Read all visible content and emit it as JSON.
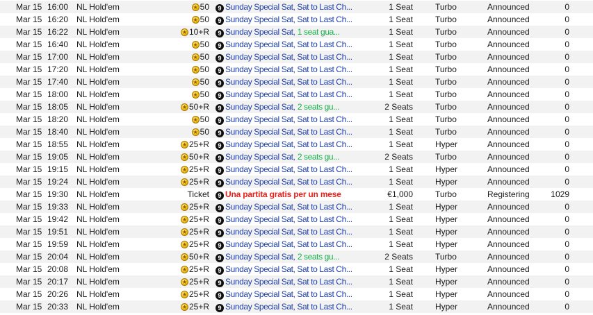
{
  "rows": [
    {
      "date": "Mar 15",
      "time": "16:00",
      "game": "NL Hold'em",
      "buyin": "50",
      "name": "Sunday Special Sat, Sat to Last Ch...",
      "name_extra": "",
      "prize": "1 Seat",
      "speed": "Turbo",
      "status": "Announced",
      "players": "0"
    },
    {
      "date": "Mar 15",
      "time": "16:20",
      "game": "NL Hold'em",
      "buyin": "50",
      "name": "Sunday Special Sat, Sat to Last Ch...",
      "name_extra": "",
      "prize": "1 Seat",
      "speed": "Turbo",
      "status": "Announced",
      "players": "0"
    },
    {
      "date": "Mar 15",
      "time": "16:22",
      "game": "NL Hold'em",
      "buyin": "10+R",
      "name": "Sunday Special Sat,",
      "name_extra": "1 seat gua...",
      "prize": "1 Seat",
      "speed": "Turbo",
      "status": "Announced",
      "players": "0"
    },
    {
      "date": "Mar 15",
      "time": "16:40",
      "game": "NL Hold'em",
      "buyin": "50",
      "name": "Sunday Special Sat, Sat to Last Ch...",
      "name_extra": "",
      "prize": "1 Seat",
      "speed": "Turbo",
      "status": "Announced",
      "players": "0"
    },
    {
      "date": "Mar 15",
      "time": "17:00",
      "game": "NL Hold'em",
      "buyin": "50",
      "name": "Sunday Special Sat, Sat to Last Ch...",
      "name_extra": "",
      "prize": "1 Seat",
      "speed": "Turbo",
      "status": "Announced",
      "players": "0"
    },
    {
      "date": "Mar 15",
      "time": "17:20",
      "game": "NL Hold'em",
      "buyin": "50",
      "name": "Sunday Special Sat, Sat to Last Ch...",
      "name_extra": "",
      "prize": "1 Seat",
      "speed": "Turbo",
      "status": "Announced",
      "players": "0"
    },
    {
      "date": "Mar 15",
      "time": "17:40",
      "game": "NL Hold'em",
      "buyin": "50",
      "name": "Sunday Special Sat, Sat to Last Ch...",
      "name_extra": "",
      "prize": "1 Seat",
      "speed": "Turbo",
      "status": "Announced",
      "players": "0"
    },
    {
      "date": "Mar 15",
      "time": "18:00",
      "game": "NL Hold'em",
      "buyin": "50",
      "name": "Sunday Special Sat, Sat to Last Ch...",
      "name_extra": "",
      "prize": "1 Seat",
      "speed": "Turbo",
      "status": "Announced",
      "players": "0"
    },
    {
      "date": "Mar 15",
      "time": "18:05",
      "game": "NL Hold'em",
      "buyin": "50+R",
      "name": "Sunday Special Sat,",
      "name_extra": "2 seats gu...",
      "prize": "2 Seats",
      "speed": "Turbo",
      "status": "Announced",
      "players": "0"
    },
    {
      "date": "Mar 15",
      "time": "18:20",
      "game": "NL Hold'em",
      "buyin": "50",
      "name": "Sunday Special Sat, Sat to Last Ch...",
      "name_extra": "",
      "prize": "1 Seat",
      "speed": "Turbo",
      "status": "Announced",
      "players": "0"
    },
    {
      "date": "Mar 15",
      "time": "18:40",
      "game": "NL Hold'em",
      "buyin": "50",
      "name": "Sunday Special Sat, Sat to Last Ch...",
      "name_extra": "",
      "prize": "1 Seat",
      "speed": "Turbo",
      "status": "Announced",
      "players": "0"
    },
    {
      "date": "Mar 15",
      "time": "18:55",
      "game": "NL Hold'em",
      "buyin": "25+R",
      "name": "Sunday Special Sat, Sat to Last Ch...",
      "name_extra": "",
      "prize": "1 Seat",
      "speed": "Hyper",
      "status": "Announced",
      "players": "0"
    },
    {
      "date": "Mar 15",
      "time": "19:05",
      "game": "NL Hold'em",
      "buyin": "50+R",
      "name": "Sunday Special Sat,",
      "name_extra": "2 seats gu...",
      "prize": "2 Seats",
      "speed": "Turbo",
      "status": "Announced",
      "players": "0"
    },
    {
      "date": "Mar 15",
      "time": "19:15",
      "game": "NL Hold'em",
      "buyin": "25+R",
      "name": "Sunday Special Sat, Sat to Last Ch...",
      "name_extra": "",
      "prize": "1 Seat",
      "speed": "Hyper",
      "status": "Announced",
      "players": "0"
    },
    {
      "date": "Mar 15",
      "time": "19:24",
      "game": "NL Hold'em",
      "buyin": "25+R",
      "name": "Sunday Special Sat, Sat to Last Ch...",
      "name_extra": "",
      "prize": "1 Seat",
      "speed": "Hyper",
      "status": "Announced",
      "players": "0"
    },
    {
      "date": "Mar 15",
      "time": "19:30",
      "game": "NL Hold'em",
      "buyin": "Ticket",
      "name": "Una partita gratis per un mese",
      "name_extra": "",
      "highlight": true,
      "prize": "€1,000",
      "speed": "Turbo",
      "status": "Registering",
      "players": "1029"
    },
    {
      "date": "Mar 15",
      "time": "19:33",
      "game": "NL Hold'em",
      "buyin": "25+R",
      "name": "Sunday Special Sat, Sat to Last Ch...",
      "name_extra": "",
      "prize": "1 Seat",
      "speed": "Hyper",
      "status": "Announced",
      "players": "0"
    },
    {
      "date": "Mar 15",
      "time": "19:42",
      "game": "NL Hold'em",
      "buyin": "25+R",
      "name": "Sunday Special Sat, Sat to Last Ch...",
      "name_extra": "",
      "prize": "1 Seat",
      "speed": "Hyper",
      "status": "Announced",
      "players": "0"
    },
    {
      "date": "Mar 15",
      "time": "19:51",
      "game": "NL Hold'em",
      "buyin": "25+R",
      "name": "Sunday Special Sat, Sat to Last Ch...",
      "name_extra": "",
      "prize": "1 Seat",
      "speed": "Hyper",
      "status": "Announced",
      "players": "0"
    },
    {
      "date": "Mar 15",
      "time": "19:59",
      "game": "NL Hold'em",
      "buyin": "25+R",
      "name": "Sunday Special Sat, Sat to Last Ch...",
      "name_extra": "",
      "prize": "1 Seat",
      "speed": "Hyper",
      "status": "Announced",
      "players": "0"
    },
    {
      "date": "Mar 15",
      "time": "20:04",
      "game": "NL Hold'em",
      "buyin": "50+R",
      "name": "Sunday Special Sat,",
      "name_extra": "2 seats gu...",
      "prize": "2 Seats",
      "speed": "Turbo",
      "status": "Announced",
      "players": "0"
    },
    {
      "date": "Mar 15",
      "time": "20:08",
      "game": "NL Hold'em",
      "buyin": "25+R",
      "name": "Sunday Special Sat, Sat to Last Ch...",
      "name_extra": "",
      "prize": "1 Seat",
      "speed": "Hyper",
      "status": "Announced",
      "players": "0"
    },
    {
      "date": "Mar 15",
      "time": "20:17",
      "game": "NL Hold'em",
      "buyin": "25+R",
      "name": "Sunday Special Sat, Sat to Last Ch...",
      "name_extra": "",
      "prize": "1 Seat",
      "speed": "Hyper",
      "status": "Announced",
      "players": "0"
    },
    {
      "date": "Mar 15",
      "time": "20:26",
      "game": "NL Hold'em",
      "buyin": "25+R",
      "name": "Sunday Special Sat, Sat to Last Ch...",
      "name_extra": "",
      "prize": "1 Seat",
      "speed": "Hyper",
      "status": "Announced",
      "players": "0"
    },
    {
      "date": "Mar 15",
      "time": "20:33",
      "game": "NL Hold'em",
      "buyin": "25+R",
      "name": "Sunday Special Sat, Sat to Last Ch...",
      "name_extra": "",
      "prize": "1 Seat",
      "speed": "Hyper",
      "status": "Announced",
      "players": "0"
    }
  ],
  "badge_glyph": "9",
  "icons": {
    "buyin": "gold-coin-icon",
    "tournament": "number-badge-icon"
  },
  "colors": {
    "name": "#1f3fa8",
    "guarantee": "#18b04a",
    "highlight": "#e8201a",
    "alt_row": "#f2f2f2"
  }
}
